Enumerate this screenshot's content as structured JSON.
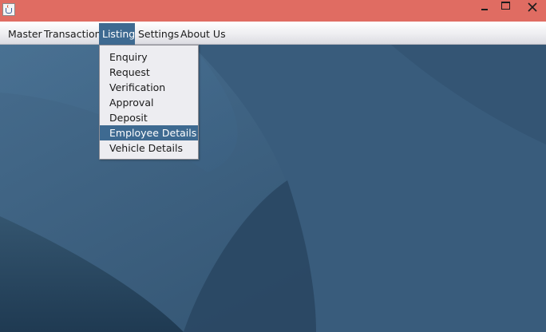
{
  "window": {
    "titlebar_color": "#e06c62",
    "app_icon": "java-cup-icon",
    "controls": {
      "minimize_icon": "minimize-icon",
      "maximize_icon": "maximize-icon",
      "close_icon": "close-icon"
    }
  },
  "menubar": {
    "items": [
      {
        "label": "Master"
      },
      {
        "label": "Transaction"
      },
      {
        "label": "Listing"
      },
      {
        "label": "Settings"
      },
      {
        "label": "About Us"
      }
    ],
    "active_item": "Listing",
    "highlight_color": "#3e6a91"
  },
  "dropdown": {
    "items": [
      {
        "label": "Enquiry"
      },
      {
        "label": "Request"
      },
      {
        "label": "Verification"
      },
      {
        "label": "Approval"
      },
      {
        "label": "Deposit"
      },
      {
        "label": "Employee Details"
      },
      {
        "label": "Vehicle Details"
      }
    ],
    "selected_item": "Employee Details"
  },
  "desktop": {
    "background_color": "#3f6587"
  }
}
